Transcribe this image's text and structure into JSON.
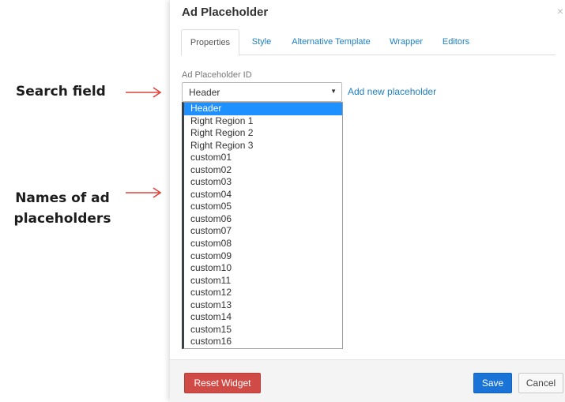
{
  "annotations": {
    "search_field": "Search field",
    "names_line1": "Names of ad",
    "names_line2": "placeholders",
    "arrow_color": "#e0433a"
  },
  "dialog": {
    "title": "Ad Placeholder",
    "close_glyph": "×",
    "tabs": [
      {
        "label": "Properties",
        "active": true
      },
      {
        "label": "Style",
        "active": false
      },
      {
        "label": "Alternative Template",
        "active": false
      },
      {
        "label": "Wrapper",
        "active": false
      },
      {
        "label": "Editors",
        "active": false
      }
    ],
    "field_label": "Ad Placeholder ID",
    "select_value": "Header",
    "caret_glyph": "▼",
    "add_link": "Add new placeholder",
    "options": [
      "Header",
      "Right Region 1",
      "Right Region 2",
      "Right Region 3",
      "custom01",
      "custom02",
      "custom03",
      "custom04",
      "custom05",
      "custom06",
      "custom07",
      "custom08",
      "custom09",
      "custom10",
      "custom11",
      "custom12",
      "custom13",
      "custom14",
      "custom15",
      "custom16"
    ],
    "selected_option": "Header",
    "buttons": {
      "reset": "Reset Widget",
      "save": "Save",
      "cancel": "Cancel"
    }
  }
}
